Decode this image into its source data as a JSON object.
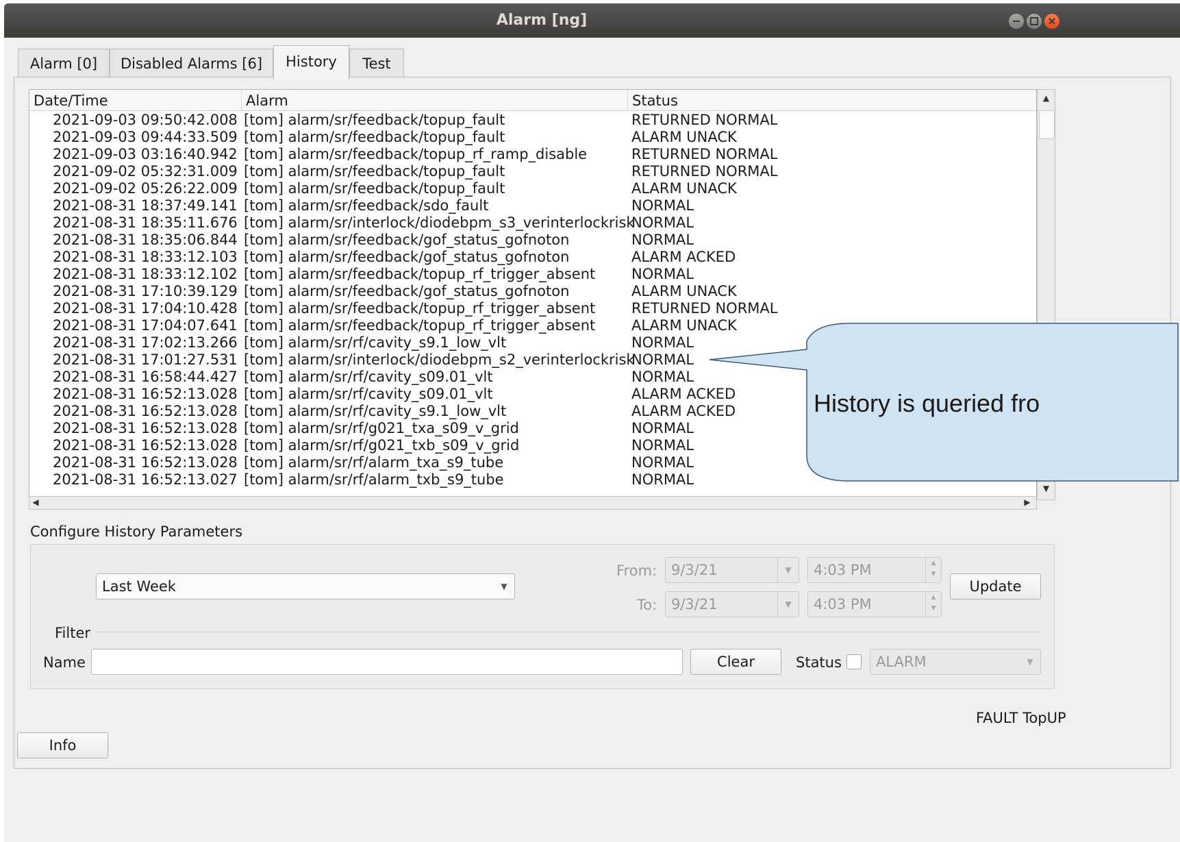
{
  "window": {
    "title": "Alarm [ng]",
    "controls": [
      "minimize-icon",
      "maximize-icon",
      "close-icon"
    ]
  },
  "tabs": [
    {
      "label": "Alarm [0]"
    },
    {
      "label": "Disabled Alarms [6]"
    },
    {
      "label": "History",
      "active": true
    },
    {
      "label": "Test"
    }
  ],
  "history_table": {
    "columns": [
      "Date/Time",
      "Alarm",
      "Status"
    ],
    "rows": [
      {
        "date": "2021-09-03 09:50:42.008",
        "alarm": "[tom] alarm/sr/feedback/topup_fault",
        "status": "RETURNED NORMAL"
      },
      {
        "date": "2021-09-03 09:44:33.509",
        "alarm": "[tom] alarm/sr/feedback/topup_fault",
        "status": "ALARM UNACK"
      },
      {
        "date": "2021-09-03 03:16:40.942",
        "alarm": "[tom] alarm/sr/feedback/topup_rf_ramp_disable",
        "status": "RETURNED NORMAL"
      },
      {
        "date": "2021-09-02 05:32:31.009",
        "alarm": "[tom] alarm/sr/feedback/topup_fault",
        "status": "RETURNED NORMAL"
      },
      {
        "date": "2021-09-02 05:26:22.009",
        "alarm": "[tom] alarm/sr/feedback/topup_fault",
        "status": "ALARM UNACK"
      },
      {
        "date": "2021-08-31 18:37:49.141",
        "alarm": "[tom] alarm/sr/feedback/sdo_fault",
        "status": "NORMAL"
      },
      {
        "date": "2021-08-31 18:35:11.676",
        "alarm": "[tom] alarm/sr/interlock/diodebpm_s3_verinterlockrisk",
        "status": "NORMAL"
      },
      {
        "date": "2021-08-31 18:35:06.844",
        "alarm": "[tom] alarm/sr/feedback/gof_status_gofnoton",
        "status": "NORMAL"
      },
      {
        "date": "2021-08-31 18:33:12.103",
        "alarm": "[tom] alarm/sr/feedback/gof_status_gofnoton",
        "status": "ALARM ACKED"
      },
      {
        "date": "2021-08-31 18:33:12.102",
        "alarm": "[tom] alarm/sr/feedback/topup_rf_trigger_absent",
        "status": "NORMAL"
      },
      {
        "date": "2021-08-31 17:10:39.129",
        "alarm": "[tom] alarm/sr/feedback/gof_status_gofnoton",
        "status": "ALARM UNACK"
      },
      {
        "date": "2021-08-31 17:04:10.428",
        "alarm": "[tom] alarm/sr/feedback/topup_rf_trigger_absent",
        "status": "RETURNED NORMAL"
      },
      {
        "date": "2021-08-31 17:04:07.641",
        "alarm": "[tom] alarm/sr/feedback/topup_rf_trigger_absent",
        "status": "ALARM UNACK"
      },
      {
        "date": "2021-08-31 17:02:13.266",
        "alarm": "[tom] alarm/sr/rf/cavity_s9.1_low_vlt",
        "status": "NORMAL"
      },
      {
        "date": "2021-08-31 17:01:27.531",
        "alarm": "[tom] alarm/sr/interlock/diodebpm_s2_verinterlockrisk",
        "status": "NORMAL"
      },
      {
        "date": "2021-08-31 16:58:44.427",
        "alarm": "[tom] alarm/sr/rf/cavity_s09.01_vlt",
        "status": "NORMAL"
      },
      {
        "date": "2021-08-31 16:52:13.028",
        "alarm": "[tom] alarm/sr/rf/cavity_s09.01_vlt",
        "status": "ALARM ACKED"
      },
      {
        "date": "2021-08-31 16:52:13.028",
        "alarm": "[tom] alarm/sr/rf/cavity_s9.1_low_vlt",
        "status": "ALARM ACKED"
      },
      {
        "date": "2021-08-31 16:52:13.028",
        "alarm": "[tom] alarm/sr/rf/g021_txa_s09_v_grid",
        "status": "NORMAL"
      },
      {
        "date": "2021-08-31 16:52:13.028",
        "alarm": "[tom] alarm/sr/rf/g021_txb_s09_v_grid",
        "status": "NORMAL"
      },
      {
        "date": "2021-08-31 16:52:13.028",
        "alarm": "[tom] alarm/sr/rf/alarm_txa_s9_tube",
        "status": "NORMAL"
      },
      {
        "date": "2021-08-31 16:52:13.027",
        "alarm": "[tom] alarm/sr/rf/alarm_txb_s9_tube",
        "status": "NORMAL"
      }
    ]
  },
  "config": {
    "group_title": "Configure History Parameters",
    "period_value": "Last Week",
    "from_label": "From:",
    "from_date": "9/3/21",
    "from_time": "4:03 PM",
    "to_label": "To:",
    "to_date": "9/3/21",
    "to_time": "4:03 PM",
    "update_label": "Update"
  },
  "filter": {
    "title": "Filter",
    "name_label": "Name",
    "name_value": "",
    "clear_label": "Clear",
    "status_label": "Status",
    "status_checked": false,
    "status_value": "ALARM"
  },
  "status_bar_text": "FAULT TopUP",
  "info_label": "Info",
  "callout_text": "History is queried fro",
  "colors": {
    "titlebar": "#3c3b37",
    "window_bg": "#efefef",
    "callout_fill": "#cfe3f2",
    "close_button": "#e0491a"
  }
}
